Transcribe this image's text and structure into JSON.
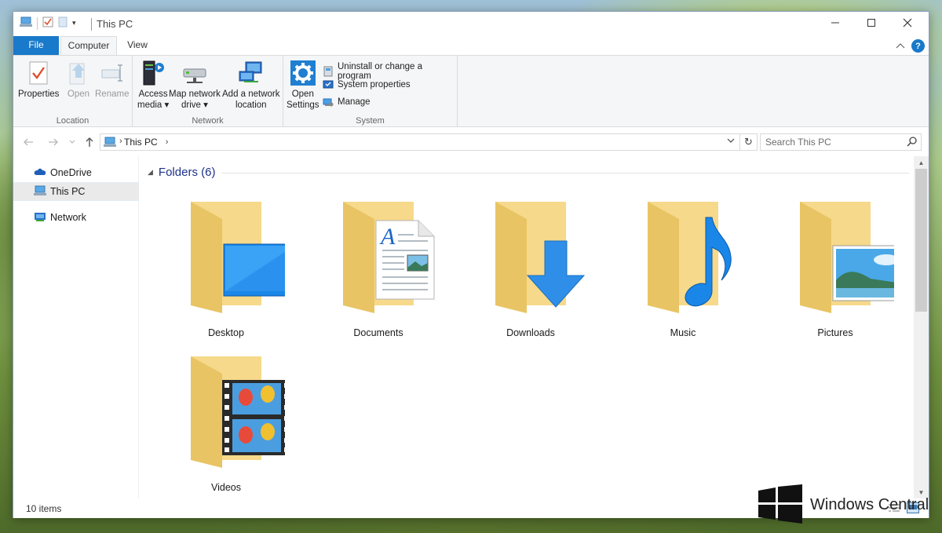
{
  "window": {
    "title": "This PC"
  },
  "tabs": {
    "file": "File",
    "computer": "Computer",
    "view": "View"
  },
  "ribbon": {
    "location": {
      "label": "Location",
      "properties": "Properties",
      "open": "Open",
      "rename": "Rename"
    },
    "network": {
      "label": "Network",
      "access_media_1": "Access",
      "access_media_2": "media",
      "map_drive_1": "Map network",
      "map_drive_2": "drive",
      "add_location_1": "Add a network",
      "add_location_2": "location"
    },
    "system": {
      "label": "System",
      "open_settings_1": "Open",
      "open_settings_2": "Settings",
      "uninstall": "Uninstall or change a program",
      "system_properties": "System properties",
      "manage": "Manage"
    }
  },
  "address": {
    "crumb": "This PC",
    "search_placeholder": "Search This PC"
  },
  "nav": {
    "onedrive": "OneDrive",
    "this_pc": "This PC",
    "network": "Network"
  },
  "section": {
    "title": "Folders (6)"
  },
  "folders": [
    {
      "label": "Desktop"
    },
    {
      "label": "Documents"
    },
    {
      "label": "Downloads"
    },
    {
      "label": "Music"
    },
    {
      "label": "Pictures"
    },
    {
      "label": "Videos"
    }
  ],
  "status": {
    "count": "10 items"
  },
  "watermark": {
    "text": "Windows Central"
  },
  "colors": {
    "accent": "#1979ca",
    "folder": "#f6d98a",
    "folder_dark": "#e8c464",
    "heading": "#1e3287"
  }
}
